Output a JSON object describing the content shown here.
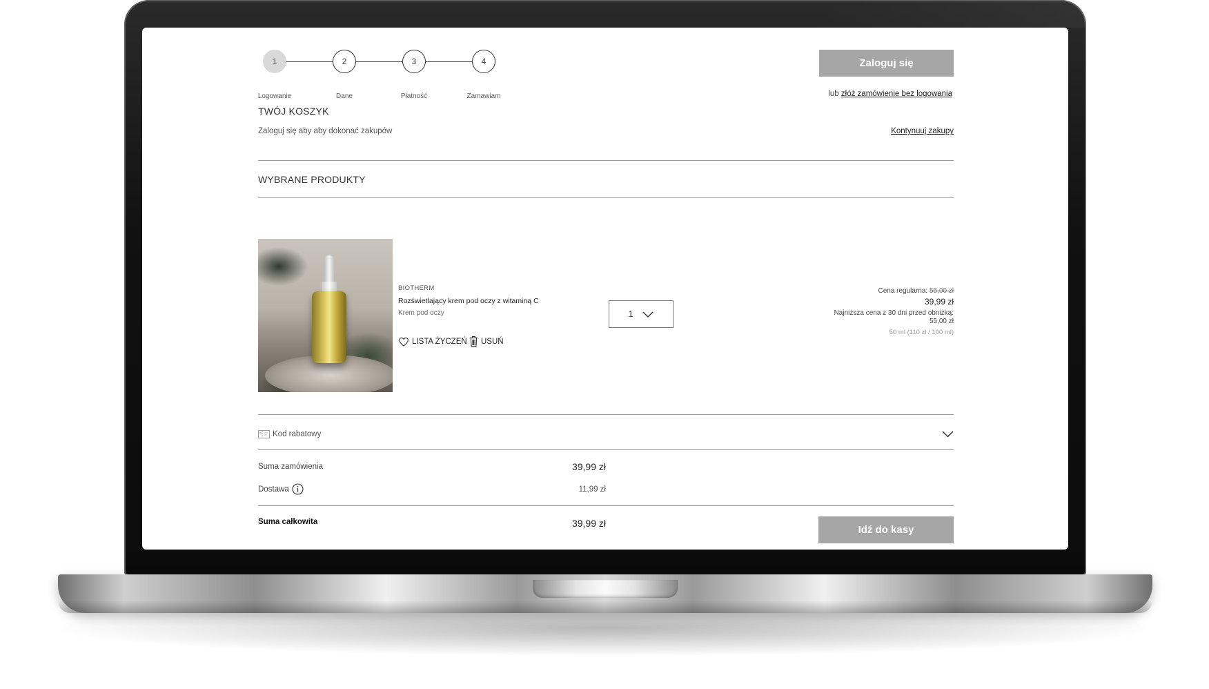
{
  "steps": [
    {
      "number": "1",
      "label": "Logowanie"
    },
    {
      "number": "2",
      "label": "Dane"
    },
    {
      "number": "3",
      "label": "Płatność"
    },
    {
      "number": "4",
      "label": "Zamawiam"
    }
  ],
  "header": {
    "login_button": "Zaloguj się",
    "or_text": "lub",
    "guest_link": "złóż zamówienie bez logowania"
  },
  "cart": {
    "title": "TWÓJ KOSZYK",
    "subtitle": "Zaloguj się aby aby dokonać zakupów",
    "continue_link": "Kontynuuj zakupy"
  },
  "products_section": {
    "title": "WYBRANE PRODUKTY"
  },
  "product": {
    "brand": "BIOTHERM",
    "name": "Rozświetlający krem pod oczy z witaminą C",
    "category": "Krem pod oczy",
    "wishlist_label": "LISTA ŻYCZEŃ",
    "remove_label": "USUŃ",
    "quantity": "1",
    "regular_price_label": "Cena regularna:",
    "regular_price": "55,00 zł",
    "price": "39,99 zł",
    "lowest_price_label": "Najniższa cena z 30 dni przed obniżką:",
    "lowest_price": "55,00 zł",
    "unit_info": "50 ml (110 zł / 100 ml)"
  },
  "discount": {
    "label": "Kod rabatowy"
  },
  "summary": {
    "order_sum_label": "Suma zamówienia",
    "order_sum_value": "39,99 zł",
    "delivery_label": "Dostawa",
    "delivery_value": "11,99 zł",
    "total_label": "Suma całkowita",
    "total_value": "39,99 zł",
    "checkout_button": "Idź do kasy"
  },
  "colors": {
    "button_bg": "#a6a6a6",
    "active_step": "#d9d9d9",
    "divider": "#9a9a9a"
  }
}
